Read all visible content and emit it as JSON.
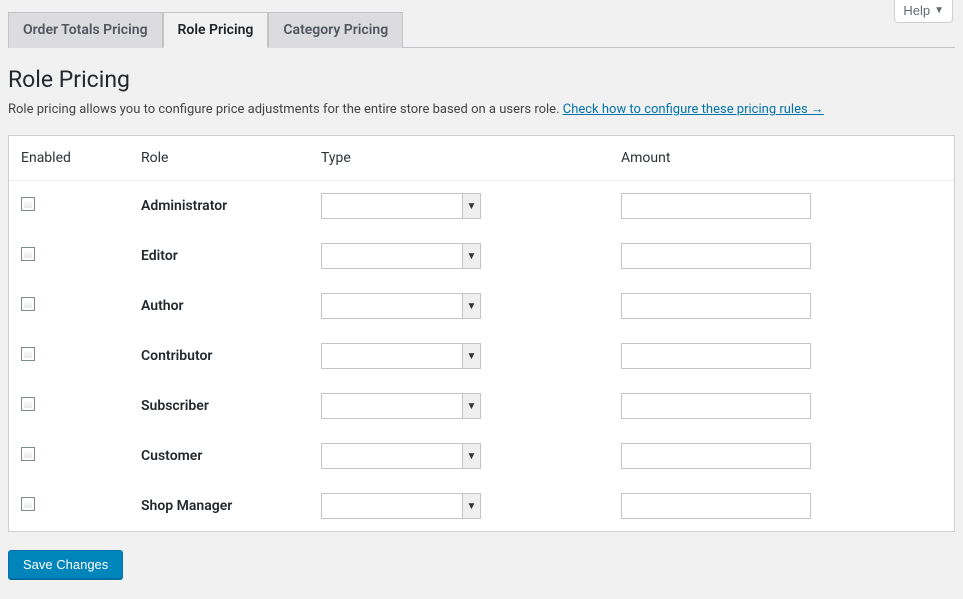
{
  "help": {
    "label": "Help"
  },
  "tabs": [
    {
      "label": "Order Totals Pricing",
      "active": false
    },
    {
      "label": "Role Pricing",
      "active": true
    },
    {
      "label": "Category Pricing",
      "active": false
    }
  ],
  "page": {
    "title": "Role Pricing",
    "description_prefix": "Role pricing allows you to configure price adjustments for the entire store based on a users role. ",
    "description_link": "Check how to configure these pricing rules →"
  },
  "table": {
    "headers": {
      "enabled": "Enabled",
      "role": "Role",
      "type": "Type",
      "amount": "Amount"
    },
    "rows": [
      {
        "enabled": false,
        "role": "Administrator",
        "type": "",
        "amount": ""
      },
      {
        "enabled": false,
        "role": "Editor",
        "type": "",
        "amount": ""
      },
      {
        "enabled": false,
        "role": "Author",
        "type": "",
        "amount": ""
      },
      {
        "enabled": false,
        "role": "Contributor",
        "type": "",
        "amount": ""
      },
      {
        "enabled": false,
        "role": "Subscriber",
        "type": "",
        "amount": ""
      },
      {
        "enabled": false,
        "role": "Customer",
        "type": "",
        "amount": ""
      },
      {
        "enabled": false,
        "role": "Shop Manager",
        "type": "",
        "amount": ""
      }
    ]
  },
  "actions": {
    "save": "Save Changes"
  }
}
